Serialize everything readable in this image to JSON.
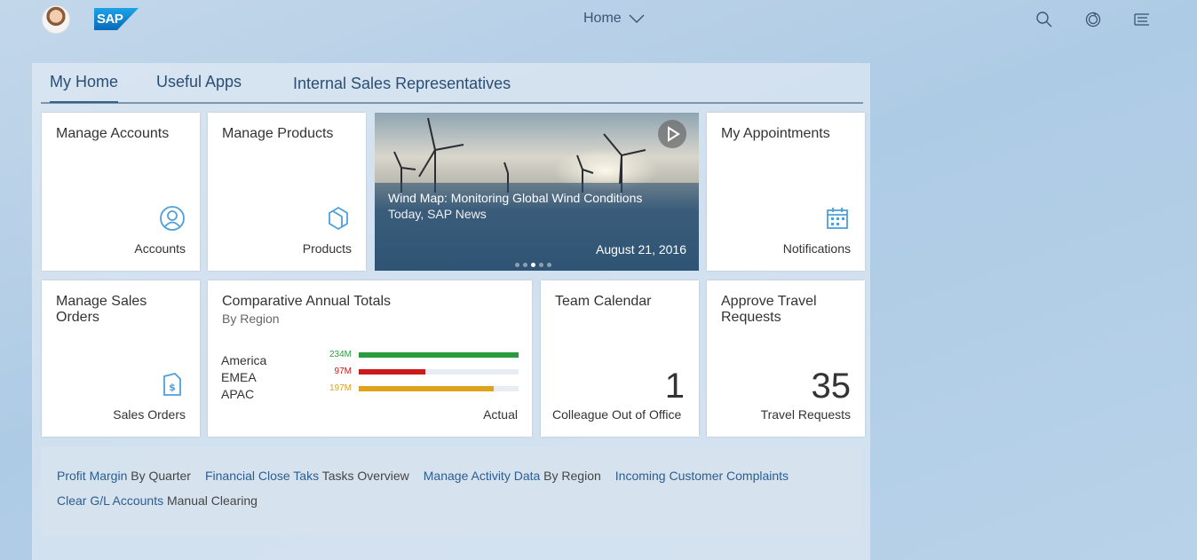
{
  "shell": {
    "logo": "SAP",
    "title": "Home",
    "icons": [
      "search-icon",
      "notifications-icon",
      "menu-icon"
    ]
  },
  "tabs": [
    {
      "label": "My Home",
      "active": true
    },
    {
      "label": "Useful Apps",
      "active": false
    },
    {
      "label": "Internal Sales Representatives",
      "active": false
    }
  ],
  "tiles": {
    "accounts": {
      "title": "Manage Accounts",
      "footer": "Accounts",
      "icon": "person-icon"
    },
    "products": {
      "title": "Manage Products",
      "footer": "Products",
      "icon": "product-icon"
    },
    "news": {
      "title": "Wind Map: Monitoring Global Wind Conditions",
      "subtitle": "Today, SAP News",
      "date": "August 21, 2016",
      "dots": 5,
      "active_dot": 3
    },
    "appointments": {
      "title": "My Appointments",
      "footer": "Notifications",
      "icon": "calendar-icon"
    },
    "sales_orders": {
      "title": "Manage Sales Orders",
      "footer": "Sales Orders",
      "icon": "sales-document-icon"
    },
    "annual_totals": {
      "title": "Comparative Annual Totals",
      "subtitle": "By Region",
      "footer": "Actual"
    },
    "team_calendar": {
      "title": "Team Calendar",
      "kpi": "1",
      "footer": "Colleague Out of Office"
    },
    "travel": {
      "title": "Approve Travel Requests",
      "kpi": "35",
      "footer": "Travel Requests"
    }
  },
  "chart_data": {
    "type": "bar",
    "categories": [
      "America",
      "EMEA",
      "APAC"
    ],
    "values": [
      234,
      97,
      197
    ],
    "labels": [
      "234M",
      "97M",
      "197M"
    ],
    "colors": [
      "#2b9b3e",
      "#cc1919",
      "#dea21c"
    ],
    "xlim": [
      0,
      234
    ]
  },
  "links": {
    "line1": [
      {
        "a": "Profit Margin",
        "b": "By Quarter"
      },
      {
        "a": "Financial Close Taks",
        "b": "Tasks Overview"
      },
      {
        "a": "Manage Activity Data",
        "b": "By Region"
      },
      {
        "a": "Incoming Customer Complaints",
        "b": ""
      }
    ],
    "line2": [
      {
        "a": "Clear G/L Accounts",
        "b": "Manual Clearing"
      }
    ]
  }
}
